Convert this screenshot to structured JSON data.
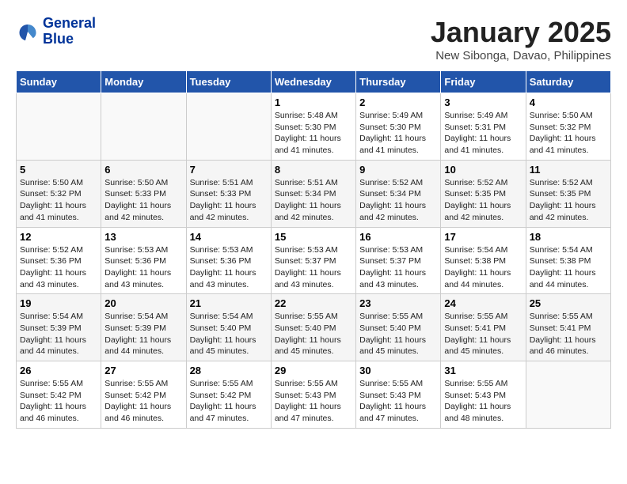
{
  "header": {
    "logo_line1": "General",
    "logo_line2": "Blue",
    "month_title": "January 2025",
    "subtitle": "New Sibonga, Davao, Philippines"
  },
  "weekdays": [
    "Sunday",
    "Monday",
    "Tuesday",
    "Wednesday",
    "Thursday",
    "Friday",
    "Saturday"
  ],
  "weeks": [
    [
      {
        "day": "",
        "info": ""
      },
      {
        "day": "",
        "info": ""
      },
      {
        "day": "",
        "info": ""
      },
      {
        "day": "1",
        "info": "Sunrise: 5:48 AM\nSunset: 5:30 PM\nDaylight: 11 hours and 41 minutes."
      },
      {
        "day": "2",
        "info": "Sunrise: 5:49 AM\nSunset: 5:30 PM\nDaylight: 11 hours and 41 minutes."
      },
      {
        "day": "3",
        "info": "Sunrise: 5:49 AM\nSunset: 5:31 PM\nDaylight: 11 hours and 41 minutes."
      },
      {
        "day": "4",
        "info": "Sunrise: 5:50 AM\nSunset: 5:32 PM\nDaylight: 11 hours and 41 minutes."
      }
    ],
    [
      {
        "day": "5",
        "info": "Sunrise: 5:50 AM\nSunset: 5:32 PM\nDaylight: 11 hours and 41 minutes."
      },
      {
        "day": "6",
        "info": "Sunrise: 5:50 AM\nSunset: 5:33 PM\nDaylight: 11 hours and 42 minutes."
      },
      {
        "day": "7",
        "info": "Sunrise: 5:51 AM\nSunset: 5:33 PM\nDaylight: 11 hours and 42 minutes."
      },
      {
        "day": "8",
        "info": "Sunrise: 5:51 AM\nSunset: 5:34 PM\nDaylight: 11 hours and 42 minutes."
      },
      {
        "day": "9",
        "info": "Sunrise: 5:52 AM\nSunset: 5:34 PM\nDaylight: 11 hours and 42 minutes."
      },
      {
        "day": "10",
        "info": "Sunrise: 5:52 AM\nSunset: 5:35 PM\nDaylight: 11 hours and 42 minutes."
      },
      {
        "day": "11",
        "info": "Sunrise: 5:52 AM\nSunset: 5:35 PM\nDaylight: 11 hours and 42 minutes."
      }
    ],
    [
      {
        "day": "12",
        "info": "Sunrise: 5:52 AM\nSunset: 5:36 PM\nDaylight: 11 hours and 43 minutes."
      },
      {
        "day": "13",
        "info": "Sunrise: 5:53 AM\nSunset: 5:36 PM\nDaylight: 11 hours and 43 minutes."
      },
      {
        "day": "14",
        "info": "Sunrise: 5:53 AM\nSunset: 5:36 PM\nDaylight: 11 hours and 43 minutes."
      },
      {
        "day": "15",
        "info": "Sunrise: 5:53 AM\nSunset: 5:37 PM\nDaylight: 11 hours and 43 minutes."
      },
      {
        "day": "16",
        "info": "Sunrise: 5:53 AM\nSunset: 5:37 PM\nDaylight: 11 hours and 43 minutes."
      },
      {
        "day": "17",
        "info": "Sunrise: 5:54 AM\nSunset: 5:38 PM\nDaylight: 11 hours and 44 minutes."
      },
      {
        "day": "18",
        "info": "Sunrise: 5:54 AM\nSunset: 5:38 PM\nDaylight: 11 hours and 44 minutes."
      }
    ],
    [
      {
        "day": "19",
        "info": "Sunrise: 5:54 AM\nSunset: 5:39 PM\nDaylight: 11 hours and 44 minutes."
      },
      {
        "day": "20",
        "info": "Sunrise: 5:54 AM\nSunset: 5:39 PM\nDaylight: 11 hours and 44 minutes."
      },
      {
        "day": "21",
        "info": "Sunrise: 5:54 AM\nSunset: 5:40 PM\nDaylight: 11 hours and 45 minutes."
      },
      {
        "day": "22",
        "info": "Sunrise: 5:55 AM\nSunset: 5:40 PM\nDaylight: 11 hours and 45 minutes."
      },
      {
        "day": "23",
        "info": "Sunrise: 5:55 AM\nSunset: 5:40 PM\nDaylight: 11 hours and 45 minutes."
      },
      {
        "day": "24",
        "info": "Sunrise: 5:55 AM\nSunset: 5:41 PM\nDaylight: 11 hours and 45 minutes."
      },
      {
        "day": "25",
        "info": "Sunrise: 5:55 AM\nSunset: 5:41 PM\nDaylight: 11 hours and 46 minutes."
      }
    ],
    [
      {
        "day": "26",
        "info": "Sunrise: 5:55 AM\nSunset: 5:42 PM\nDaylight: 11 hours and 46 minutes."
      },
      {
        "day": "27",
        "info": "Sunrise: 5:55 AM\nSunset: 5:42 PM\nDaylight: 11 hours and 46 minutes."
      },
      {
        "day": "28",
        "info": "Sunrise: 5:55 AM\nSunset: 5:42 PM\nDaylight: 11 hours and 47 minutes."
      },
      {
        "day": "29",
        "info": "Sunrise: 5:55 AM\nSunset: 5:43 PM\nDaylight: 11 hours and 47 minutes."
      },
      {
        "day": "30",
        "info": "Sunrise: 5:55 AM\nSunset: 5:43 PM\nDaylight: 11 hours and 47 minutes."
      },
      {
        "day": "31",
        "info": "Sunrise: 5:55 AM\nSunset: 5:43 PM\nDaylight: 11 hours and 48 minutes."
      },
      {
        "day": "",
        "info": ""
      }
    ]
  ]
}
